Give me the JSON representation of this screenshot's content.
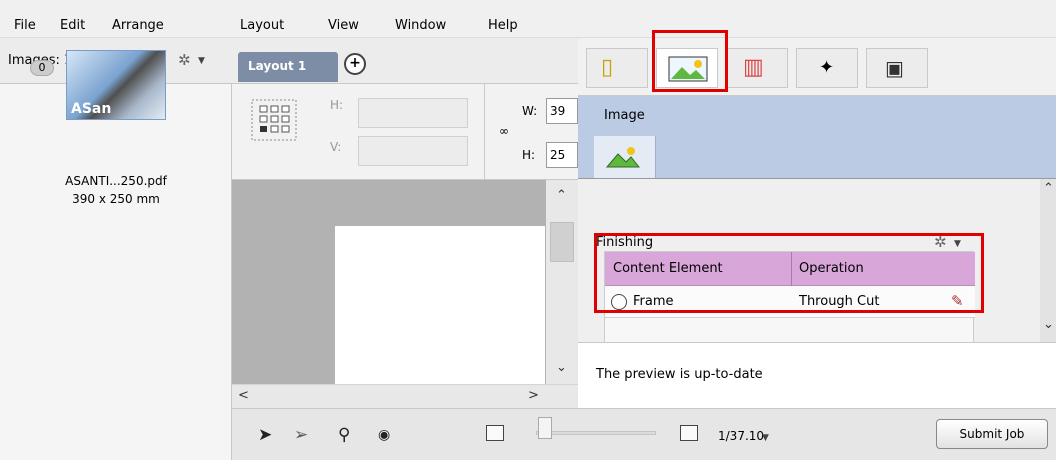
{
  "menubar": {
    "items": [
      {
        "label": "File"
      },
      {
        "label": "Edit"
      },
      {
        "label": "Arrange"
      },
      {
        "label": "Layout"
      },
      {
        "label": "View"
      },
      {
        "label": "Window"
      },
      {
        "label": "Help"
      }
    ]
  },
  "images_panel": {
    "count_label": "Images: 1/1",
    "add_label": "+",
    "thumbnail": {
      "badge": "0",
      "overlay_text": "ASan",
      "name": "ASANTI...250.pdf",
      "size": "390 x 250 mm"
    }
  },
  "layout": {
    "tab_label": "Layout 1",
    "add_label": "+"
  },
  "geometry": {
    "h_label": "H:",
    "v_label": "V:",
    "w_label": "W:",
    "w_value": "39",
    "h2_label": "H:",
    "h2_value": "25"
  },
  "inspector": {
    "title": "Image",
    "finishing": {
      "title": "Finishing",
      "columns": [
        "Content Element",
        "Operation"
      ],
      "rows": [
        {
          "element": "Frame",
          "operation": "Through Cut"
        }
      ]
    },
    "preview_status": "The preview is up-to-date"
  },
  "bottom_bar": {
    "zoom": "1/37.10",
    "submit_label": "Submit Job"
  },
  "colors": {
    "highlight": "#e00000",
    "table_header": "#d8a6d8",
    "inspector_header": "#bccbe4",
    "layout_tab": "#7d8da6"
  }
}
